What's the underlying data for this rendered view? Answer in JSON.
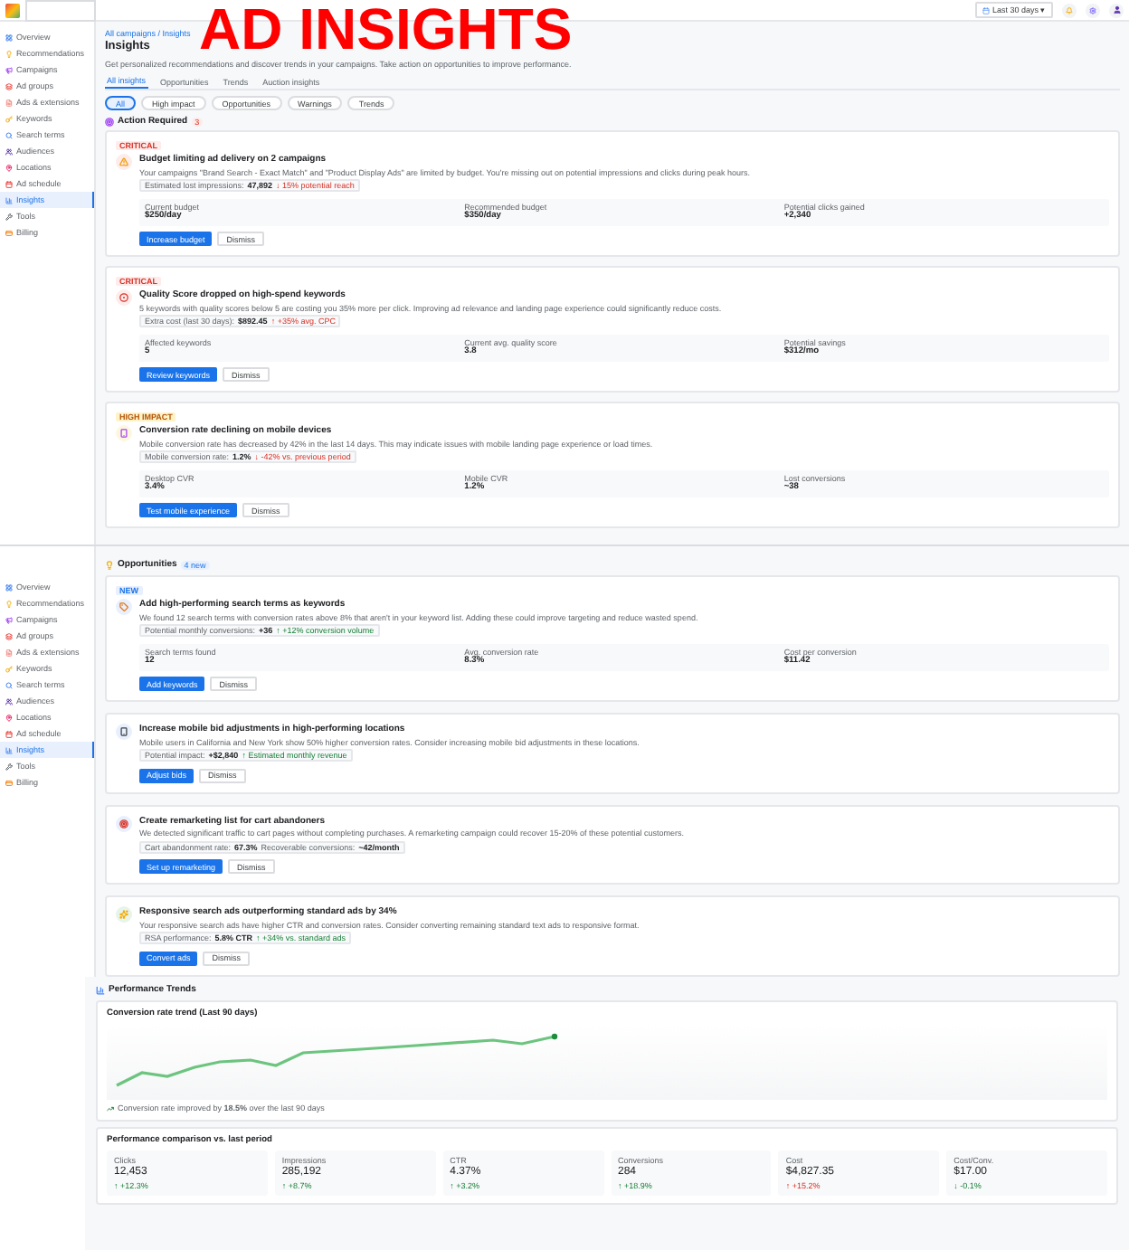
{
  "overlay_title": "AD INSIGHTS",
  "topbar": {
    "date_range": "Last 30 days",
    "caret": "▾"
  },
  "sidebar_top": {
    "items": [
      {
        "label": "Overview",
        "selected": false
      },
      {
        "label": "Recommendations",
        "selected": false
      },
      {
        "label": "Campaigns",
        "selected": false
      },
      {
        "label": "Ad groups",
        "selected": false
      },
      {
        "label": "Ads & extensions",
        "selected": false
      },
      {
        "label": "Keywords",
        "selected": false
      },
      {
        "label": "Search terms",
        "selected": false
      },
      {
        "label": "Audiences",
        "selected": false
      },
      {
        "label": "Locations",
        "selected": false
      },
      {
        "label": "Ad schedule",
        "selected": false
      },
      {
        "label": "Insights",
        "selected": true
      },
      {
        "label": "Tools",
        "selected": false
      },
      {
        "label": "Billing",
        "selected": false
      }
    ]
  },
  "page": {
    "breadcrumb": "All campaigns / Insights",
    "title": "Insights",
    "subtitle": "Get personalized recommendations and discover trends in your campaigns. Take action on opportunities to improve performance.",
    "tabs": [
      {
        "label": "All insights",
        "selected": true
      },
      {
        "label": "Opportunities",
        "selected": false
      },
      {
        "label": "Trends",
        "selected": false
      },
      {
        "label": "Auction insights",
        "selected": false
      }
    ],
    "filters": [
      {
        "label": "All",
        "selected": true
      },
      {
        "label": "High impact",
        "selected": false
      },
      {
        "label": "Opportunities",
        "selected": false
      },
      {
        "label": "Warnings",
        "selected": false
      },
      {
        "label": "Trends",
        "selected": false
      }
    ]
  },
  "action_required": {
    "title": "Action Required",
    "count": "3",
    "cards": [
      {
        "badge": {
          "label": "CRITICAL",
          "kind": "critical"
        },
        "title": "Budget limiting ad delivery on 2 campaigns",
        "description": "Your campaigns \"Brand Search - Exact Match\" and \"Product Display Ads\" are limited by budget. You're missing out on potential impressions and clicks during peak hours.",
        "pill": [
          {
            "text": "Estimated lost impressions:",
            "kind": "label"
          },
          {
            "text": "47,892",
            "kind": "value"
          },
          {
            "text": "↓ 15% potential reach",
            "kind": "delta",
            "negative": true
          }
        ],
        "metrics": [
          {
            "label": "Current budget",
            "value": "$250/day"
          },
          {
            "label": "Recommended budget",
            "value": "$350/day"
          },
          {
            "label": "Potential clicks gained",
            "value": "+2,340"
          }
        ],
        "primary": "Increase budget",
        "secondary": "Dismiss"
      },
      {
        "badge": {
          "label": "CRITICAL",
          "kind": "critical"
        },
        "title": "Quality Score dropped on high-spend keywords",
        "description": "5 keywords with quality scores below 5 are costing you 35% more per click. Improving ad relevance and landing page experience could significantly reduce costs.",
        "pill": [
          {
            "text": "Extra cost (last 30 days):",
            "kind": "label"
          },
          {
            "text": "$892.45",
            "kind": "value"
          },
          {
            "text": "↑ +35% avg. CPC",
            "kind": "delta",
            "negative": true
          }
        ],
        "metrics": [
          {
            "label": "Affected keywords",
            "value": "5"
          },
          {
            "label": "Current avg. quality score",
            "value": "3.8"
          },
          {
            "label": "Potential savings",
            "value": "$312/mo"
          }
        ],
        "primary": "Review keywords",
        "secondary": "Dismiss"
      },
      {
        "badge": {
          "label": "HIGH IMPACT",
          "kind": "high"
        },
        "title": "Conversion rate declining on mobile devices",
        "description": "Mobile conversion rate has decreased by 42% in the last 14 days. This may indicate issues with mobile landing page experience or load times.",
        "pill": [
          {
            "text": "Mobile conversion rate:",
            "kind": "label"
          },
          {
            "text": "1.2%",
            "kind": "value"
          },
          {
            "text": "↓ -42% vs. previous period",
            "kind": "delta",
            "negative": true
          }
        ],
        "metrics": [
          {
            "label": "Desktop CVR",
            "value": "3.4%"
          },
          {
            "label": "Mobile CVR",
            "value": "1.2%"
          },
          {
            "label": "Lost conversions",
            "value": "~38"
          }
        ],
        "primary": "Test mobile experience",
        "secondary": "Dismiss"
      }
    ]
  },
  "sidebar_second": {
    "items": [
      {
        "label": "Overview",
        "selected": false
      },
      {
        "label": "Recommendations",
        "selected": false
      },
      {
        "label": "Campaigns",
        "selected": false
      },
      {
        "label": "Ad groups",
        "selected": false
      },
      {
        "label": "Ads & extensions",
        "selected": false
      },
      {
        "label": "Keywords",
        "selected": false
      },
      {
        "label": "Search terms",
        "selected": false
      },
      {
        "label": "Audiences",
        "selected": false
      },
      {
        "label": "Locations",
        "selected": false
      },
      {
        "label": "Ad schedule",
        "selected": false
      },
      {
        "label": "Insights",
        "selected": true
      },
      {
        "label": "Tools",
        "selected": false
      },
      {
        "label": "Billing",
        "selected": false
      }
    ]
  },
  "opportunities": {
    "title": "Opportunities",
    "count": "4 new",
    "cards": [
      {
        "badge": {
          "label": "NEW",
          "kind": "new"
        },
        "title": "Add high-performing search terms as keywords",
        "description": "We found 12 search terms with conversion rates above 8% that aren't in your keyword list. Adding these could improve targeting and reduce wasted spend.",
        "pill": [
          {
            "text": "Potential monthly conversions:",
            "kind": "label"
          },
          {
            "text": "+36",
            "kind": "value"
          },
          {
            "text": "↑ +12% conversion volume",
            "kind": "delta",
            "negative": false
          }
        ],
        "metrics": [
          {
            "label": "Search terms found",
            "value": "12"
          },
          {
            "label": "Avg. conversion rate",
            "value": "8.3%"
          },
          {
            "label": "Cost per conversion",
            "value": "$11.42"
          }
        ],
        "primary": "Add keywords",
        "secondary": "Dismiss"
      },
      {
        "title": "Increase mobile bid adjustments in high-performing locations",
        "description": "Mobile users in California and New York show 50% higher conversion rates. Consider increasing mobile bid adjustments in these locations.",
        "pill": [
          {
            "text": "Potential impact:",
            "kind": "label"
          },
          {
            "text": "+$2,840",
            "kind": "value"
          },
          {
            "text": "↑ Estimated monthly revenue",
            "kind": "delta",
            "negative": false
          }
        ],
        "primary": "Adjust bids",
        "secondary": "Dismiss"
      },
      {
        "title": "Create remarketing list for cart abandoners",
        "description": "We detected significant traffic to cart pages without completing purchases. A remarketing campaign could recover 15-20% of these potential customers.",
        "pill": [
          {
            "text": "Cart abandonment rate:",
            "kind": "label"
          },
          {
            "text": "67.3%",
            "kind": "value"
          },
          {
            "text": "Recoverable conversions:",
            "kind": "label"
          },
          {
            "text": "~42/month",
            "kind": "value"
          }
        ],
        "primary": "Set up remarketing",
        "secondary": "Dismiss"
      },
      {
        "title": "Responsive search ads outperforming standard ads by 34%",
        "description": "Your responsive search ads have higher CTR and conversion rates. Consider converting remaining standard text ads to responsive format.",
        "pill": [
          {
            "text": "RSA performance:",
            "kind": "label"
          },
          {
            "text": "5.8% CTR",
            "kind": "value"
          },
          {
            "text": "↑ +34% vs. standard ads",
            "kind": "delta",
            "negative": false
          }
        ],
        "primary": "Convert ads",
        "secondary": "Dismiss"
      }
    ]
  },
  "performance_trends": {
    "title": "Performance Trends",
    "trend_card": {
      "title": "Conversion rate trend (Last 90 days)",
      "note": "Conversion rate improved by **18.5%** over the last 90 days"
    },
    "comparison": {
      "title": "Performance comparison vs. last period",
      "stats": [
        {
          "label": "Clicks",
          "value": "12,453",
          "change": "↑ +12.3%",
          "negative": false
        },
        {
          "label": "Impressions",
          "value": "285,192",
          "change": "↑ +8.7%",
          "negative": false
        },
        {
          "label": "CTR",
          "value": "4.37%",
          "change": "↑ +3.2%",
          "negative": false
        },
        {
          "label": "Conversions",
          "value": "284",
          "change": "↑ +18.9%",
          "negative": false
        },
        {
          "label": "Cost",
          "value": "$4,827.35",
          "change": "↑ +15.2%",
          "negative": true
        },
        {
          "label": "Cost/Conv.",
          "value": "$17.00",
          "change": "↓ -0.1%",
          "negative": false
        }
      ]
    }
  }
}
